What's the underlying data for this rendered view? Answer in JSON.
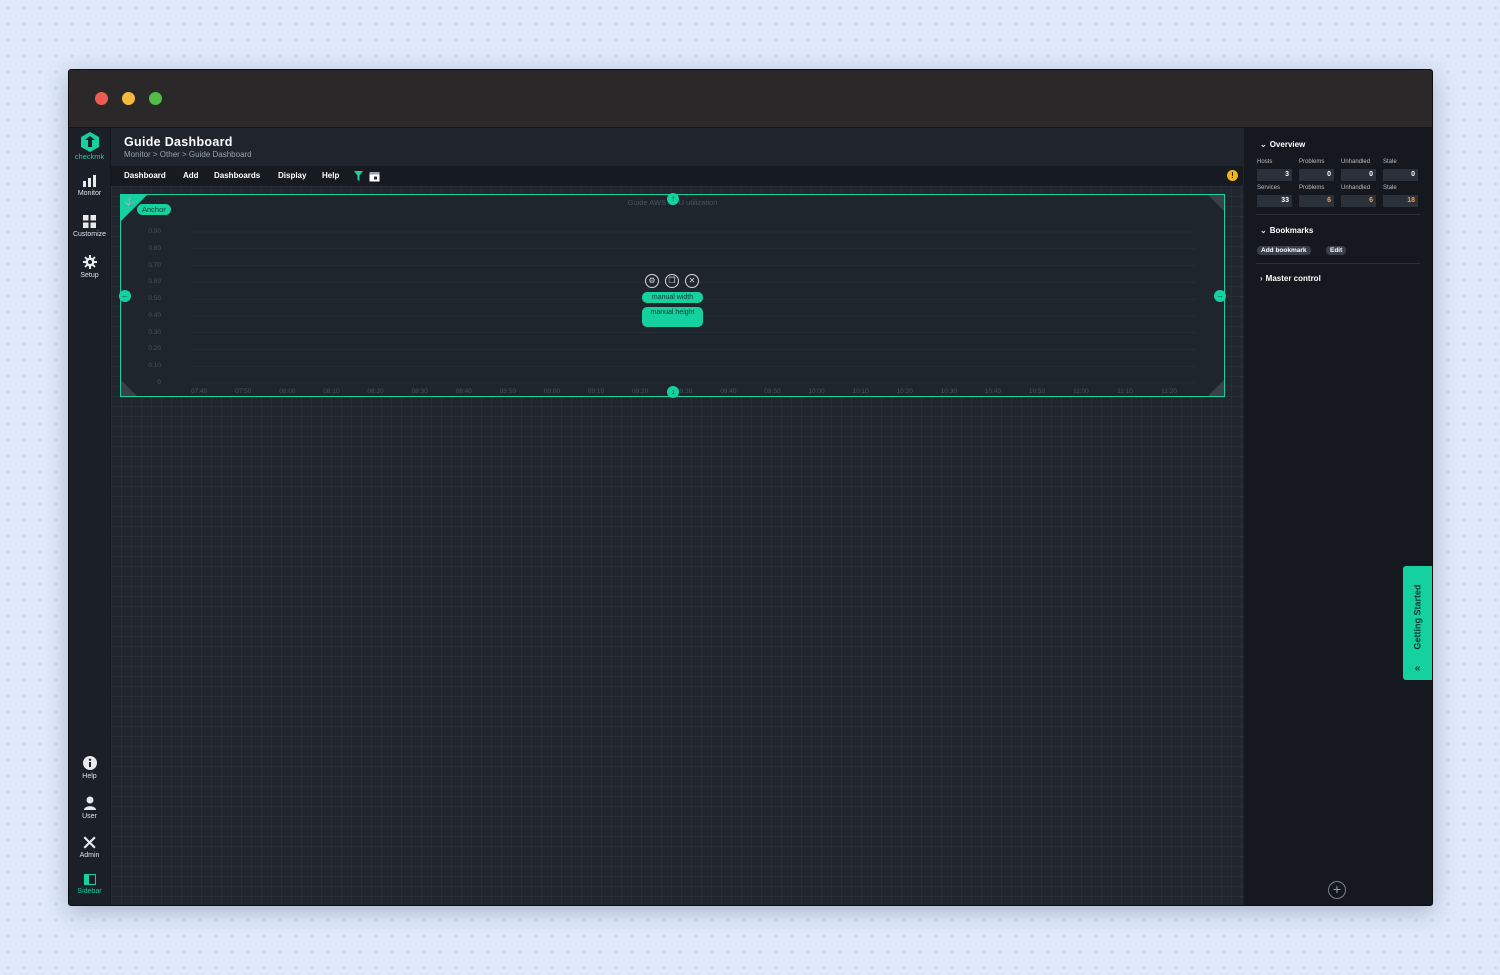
{
  "app": {
    "logo_text": "checkmk"
  },
  "nav": {
    "monitor": "Monitor",
    "customize": "Customize",
    "setup": "Setup",
    "help": "Help",
    "user": "User",
    "admin": "Admin",
    "sidebar": "Sidebar"
  },
  "header": {
    "title": "Guide Dashboard",
    "breadcrumb": "Monitor > Other > Guide Dashboard"
  },
  "menu": {
    "dashboard": "Dashboard",
    "add": "Add",
    "dashboards": "Dashboards",
    "display": "Display",
    "help": "Help"
  },
  "dashlet": {
    "title": "Guide AWS CPU utilization",
    "anchor_label": "Anchor",
    "width_button": "manual width",
    "height_button": "manual height",
    "anchor_glyph": "⚓",
    "handle_up": "↑",
    "handle_down": "↓",
    "handle_left": "←",
    "handle_right": "→",
    "settings_icon": "⚙",
    "clone_icon": "❐",
    "close_icon": "✕"
  },
  "chart_data": {
    "type": "line",
    "title": "Guide AWS CPU utilization",
    "y_ticks": [
      "0.90",
      "0.80",
      "0.70",
      "0.60",
      "0.50",
      "0.40",
      "0.30",
      "0.20",
      "0.10",
      "0"
    ],
    "x_ticks": [
      "07:40",
      "07:50",
      "08:00",
      "08:10",
      "08:20",
      "08:30",
      "08:40",
      "08:50",
      "09:00",
      "09:10",
      "09:20",
      "09:30",
      "09:40",
      "09:50",
      "10:00",
      "10:10",
      "10:20",
      "10:30",
      "10:40",
      "10:50",
      "11:00",
      "11:10",
      "11:20"
    ],
    "ylim": [
      0,
      0.9
    ],
    "series": [],
    "grid": true
  },
  "sidebar": {
    "overview": {
      "heading": "Overview",
      "hosts_label": "Hosts",
      "services_label": "Services",
      "problems_label": "Problems",
      "unhandled_label": "Unhandled",
      "stale_label": "Stale",
      "hosts": {
        "total": "3",
        "problems": "0",
        "unhandled": "0",
        "stale": "0"
      },
      "services": {
        "total": "33",
        "problems": "6",
        "unhandled": "6",
        "stale": "18"
      }
    },
    "bookmarks": {
      "heading": "Bookmarks",
      "add_button": "Add bookmark",
      "edit_button": "Edit"
    },
    "master_control": {
      "heading": "Master control"
    },
    "getting_started": "Getting Started",
    "getting_started_chevron": "«",
    "add_snapin": "+"
  },
  "colors": {
    "accent": "#15d1a0",
    "warning": "#f7a23b",
    "background": "#20252e"
  }
}
